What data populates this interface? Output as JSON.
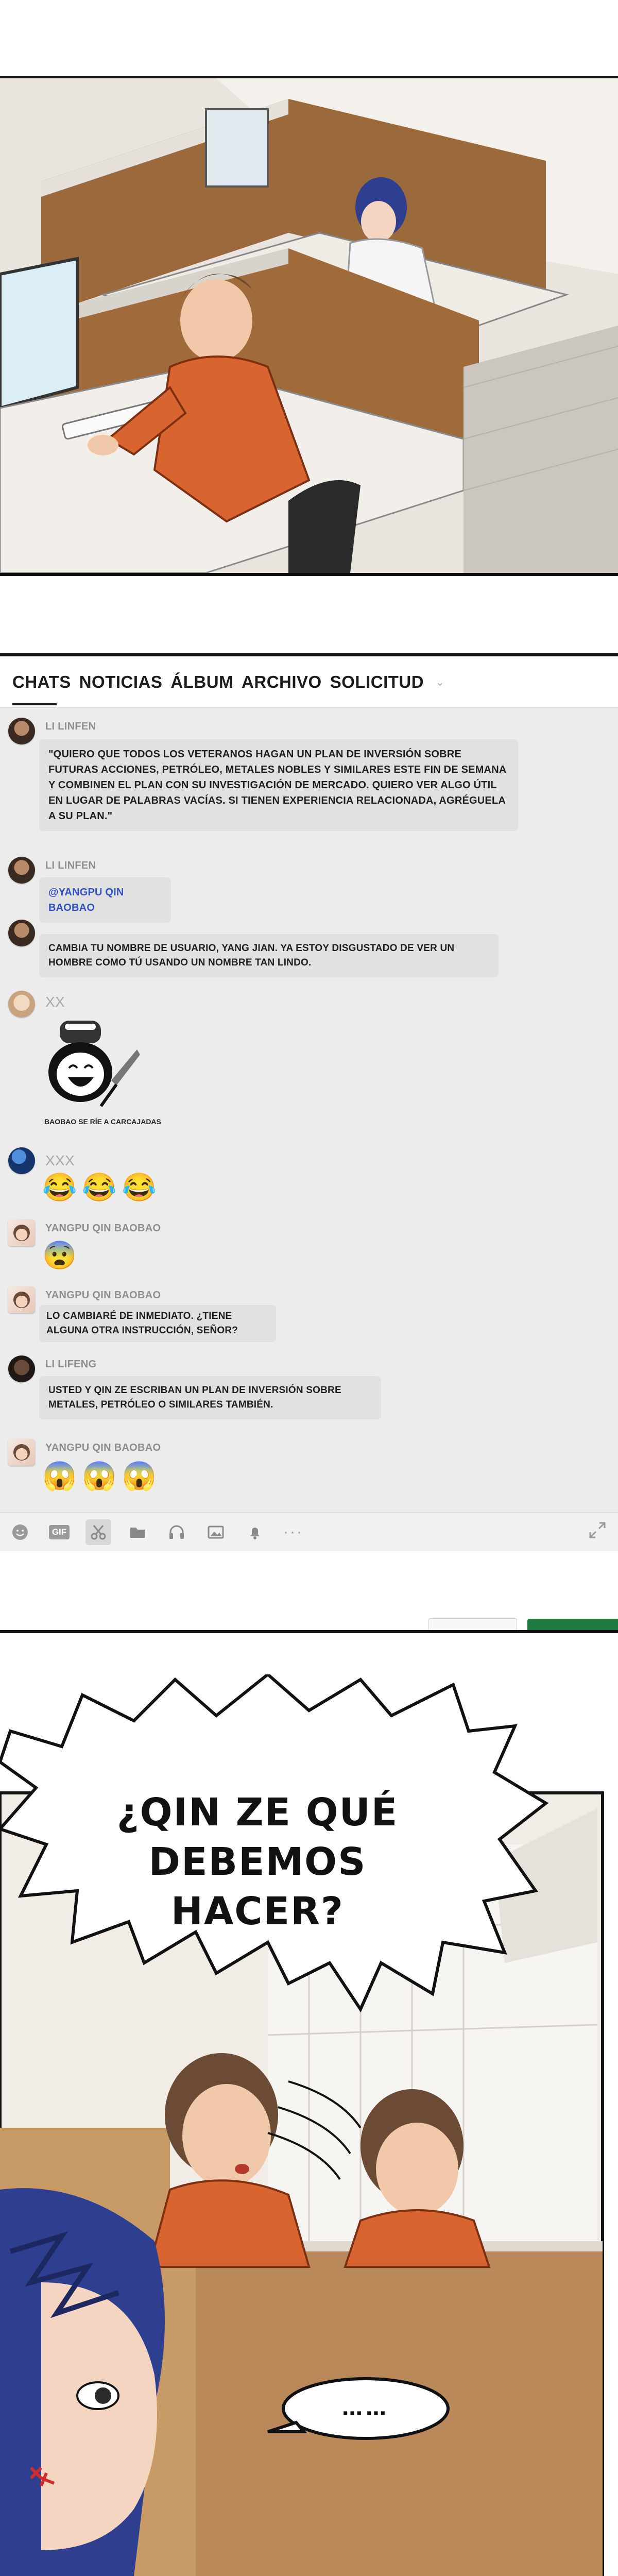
{
  "chat": {
    "tabs": [
      {
        "label": "CHATS"
      },
      {
        "label": "NOTICIAS"
      },
      {
        "label": "ÁLBUM"
      },
      {
        "label": "ARCHIVO"
      },
      {
        "label": "SOLICITUD"
      }
    ],
    "more_tabs_icon": "chevron-down-icon",
    "messages": [
      {
        "sender": "LI LINFEN",
        "text": "\"QUIERO QUE TODOS LOS VETERANOS HAGAN UN PLAN DE INVERSIÓN SOBRE FUTURAS ACCIONES, PETRÓLEO, METALES NOBLES Y SIMILARES ESTE FIN DE SEMANA Y COMBINEN EL PLAN CON SU INVESTIGACIÓN DE MERCADO. QUIERO VER ALGO ÚTIL EN LUGAR DE PALABRAS VACÍAS. SI TIENEN EXPERIENCIA RELACIONADA, AGRÉGUELA A SU PLAN.\""
      },
      {
        "sender": "LI LINFEN",
        "text": "@YANGPU QIN BAOBAO"
      },
      {
        "sender": "",
        "text": "CAMBIA TU NOMBRE DE USUARIO, YANG JIAN. YA ESTOY DISGUSTADO DE VER UN HOMBRE COMO TÚ USANDO UN NOMBRE TAN LINDO."
      },
      {
        "sender": "XX",
        "caption": "BAOBAO SE RÍE A CARCAJADAS"
      },
      {
        "sender": "XXX",
        "emojis": [
          "😂",
          "😂",
          "😂"
        ]
      },
      {
        "sender": "YANGPU QIN BAOBAO",
        "emojis": [
          "😨"
        ]
      },
      {
        "sender": "YANGPU QIN BAOBAO",
        "text": "LO CAMBIARÉ DE INMEDIATO. ¿TIENE ALGUNA OTRA INSTRUCCIÓN, SEÑOR?"
      },
      {
        "sender": "LI LIFENG",
        "text": "USTED Y QIN ZE ESCRIBAN UN PLAN DE INVERSIÓN SOBRE METALES, PETRÓLEO O SIMILARES TAMBIÉN."
      },
      {
        "sender": "YANGPU QIN BAOBAO",
        "emojis": [
          "😱",
          "😱",
          "😱"
        ]
      }
    ],
    "toolbar": {
      "gif_label": "GIF",
      "more": "···",
      "icons": [
        "smile-icon",
        "gif-icon",
        "scissors-icon",
        "folder-icon",
        "headphones-icon",
        "image-icon",
        "bell-icon",
        "more-icon",
        "expand-icon"
      ]
    }
  },
  "scene": {
    "speech": "¿QIN ZE QUÉ DEBEMOS HACER?",
    "reply": "……"
  },
  "colors": {
    "chat_background": "#ececec",
    "bubble": "#e1e1e1",
    "mention": "#3150c9",
    "send_button": "#1f7a3f",
    "shirt_orange": "#d8652f",
    "hair_blue": "#2f3f8f"
  }
}
